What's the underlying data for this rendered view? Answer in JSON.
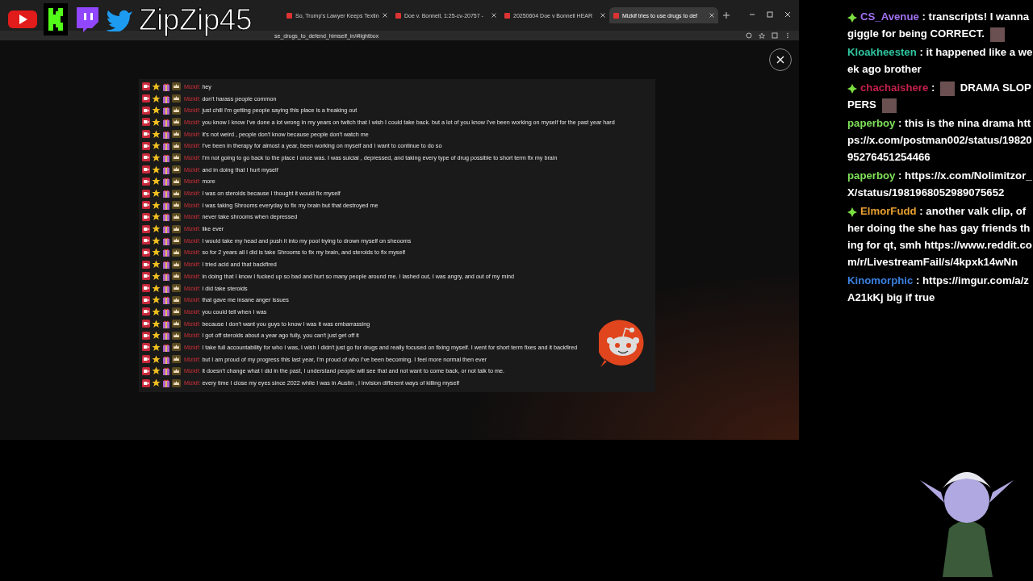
{
  "overlay": {
    "channel_name": "ZipZip45"
  },
  "browser": {
    "tabs": [
      {
        "title": "So, Trump's Lawyer Keeps Textin",
        "selected": false
      },
      {
        "title": "Doe v. Bonnell, 1:25-cv-20757 -",
        "selected": false
      },
      {
        "title": "20250604 Doe v Bonnell HEAR",
        "selected": false
      },
      {
        "title": "Mizkif tries to use drugs to def",
        "selected": true
      }
    ],
    "address": "se_drugs_to_defend_himself_in/#lightbox"
  },
  "chat_log": {
    "rows": [
      {
        "name": "Mizkif:",
        "text": "hey"
      },
      {
        "name": "Mizkif:",
        "text": "don't harass people common"
      },
      {
        "name": "Mizkif:",
        "text": "just chill I'm getting people saying this place is a freaking out"
      },
      {
        "name": "Mizkif:",
        "text": "you know I know I've done a lot wrong in my years on twitch that I wish I could take back. but a lot of you know I've been working on myself for the past year hard"
      },
      {
        "name": "Mizkif:",
        "text": "it's not weird , people don't know because people don't watch me"
      },
      {
        "name": "Mizkif:",
        "text": "I've been in therapy for almost a year, been working on myself and I want to continue to do so"
      },
      {
        "name": "Mizkif:",
        "text": "I'm not going to go back to the place I once was. I was suicial , depressed, and taking every type of drug possible to short term fix my brain"
      },
      {
        "name": "Mizkif:",
        "text": "and in doing that I hurt myself"
      },
      {
        "name": "Mizkif:",
        "text": "more"
      },
      {
        "name": "Mizkif:",
        "text": "I was on steroids because I thought it would fix myself"
      },
      {
        "name": "Mizkif:",
        "text": "I was taking Shrooms everyday to fix my brain but that destroyed me"
      },
      {
        "name": "Mizkif:",
        "text": "never take shrooms when depressed"
      },
      {
        "name": "Mizkif:",
        "text": "like ever"
      },
      {
        "name": "Mizkif:",
        "text": "I would take my head and push it into my pool trying to drown myself on sheooms"
      },
      {
        "name": "Mizkif:",
        "text": "so for 2 years all I did is take Shrooms to fix my brain, and steroids to fix myself"
      },
      {
        "name": "Mizkif:",
        "text": "I tried acid and that backfired"
      },
      {
        "name": "Mizkif:",
        "text": "in doing that I know I fucked up so bad and hurt so many people around me. I lashed out, I was angry, and out of my mind"
      },
      {
        "name": "Mizkif:",
        "text": "I did take steroids"
      },
      {
        "name": "Mizkif:",
        "text": "that gave me insane anger issues"
      },
      {
        "name": "Mizkif:",
        "text": "you could tell when I was"
      },
      {
        "name": "Mizkif:",
        "text": "because I don't want you guys to know I was it was embarrassing"
      },
      {
        "name": "Mizkif:",
        "text": "I got off steroids about a year ago fully, you can't just get off it"
      },
      {
        "name": "Mizkif:",
        "text": "I take full accountability for who I was, I wish I didn't just go for drugs and really focused on fixing myself. I went for short term fixes and it backfired"
      },
      {
        "name": "Mizkif:",
        "text": "but I am proud of my progress this last year, I'm proud of who I've been becoming. I feel more normal then ever"
      },
      {
        "name": "Mizkif:",
        "text": "it doesn't change what I did in the past, I understand people will see that and not want to come back, or not talk to me."
      },
      {
        "name": "Mizkif:",
        "text": "every time I close my eyes since 2022 while I was in Austin , I invision different ways of killing myself"
      }
    ]
  },
  "stream_chat": [
    {
      "user": "CS_Avenue",
      "color": "#a070f0",
      "badge": true,
      "separator": ":",
      "parts": [
        {
          "kind": "text",
          "text": "transcripts! I wanna giggle for being CORRECT."
        },
        {
          "kind": "emote"
        }
      ]
    },
    {
      "user": "Kloakheesten",
      "color": "#2ec4a0",
      "badge": false,
      "separator": ":",
      "parts": [
        {
          "kind": "text",
          "text": "it happened like a week ago brother"
        }
      ]
    },
    {
      "user": "chachaishere",
      "color": "#c0204a",
      "badge": true,
      "separator": ":",
      "parts": [
        {
          "kind": "emote"
        },
        {
          "kind": "text",
          "text": "DRAMA SLOPPERS"
        },
        {
          "kind": "emote"
        }
      ]
    },
    {
      "user": "paperboy",
      "color": "#7ee05a",
      "badge": false,
      "separator": ":",
      "parts": [
        {
          "kind": "text",
          "text": "this is the nina drama https://x.com/postman002/status/1982095276451254466"
        }
      ]
    },
    {
      "user": "paperboy",
      "color": "#7ee05a",
      "badge": false,
      "separator": ":",
      "parts": [
        {
          "kind": "text",
          "text": "https://x.com/Nolimitzor_X/status/1981968052989075652"
        }
      ]
    },
    {
      "user": "ElmorFudd",
      "color": "#e8a030",
      "badge": true,
      "separator": ":",
      "parts": [
        {
          "kind": "text",
          "text": "another valk clip, of her doing the she has gay friends thing for qt, smh https://www.reddit.com/r/LivestreamFail/s/4kpxk14wNn"
        }
      ]
    },
    {
      "user": "Kinomorphic",
      "color": "#3a80e0",
      "badge": false,
      "separator": ":",
      "parts": [
        {
          "kind": "text",
          "text": "https://imgur.com/a/zA21kKj big if true"
        }
      ]
    }
  ]
}
